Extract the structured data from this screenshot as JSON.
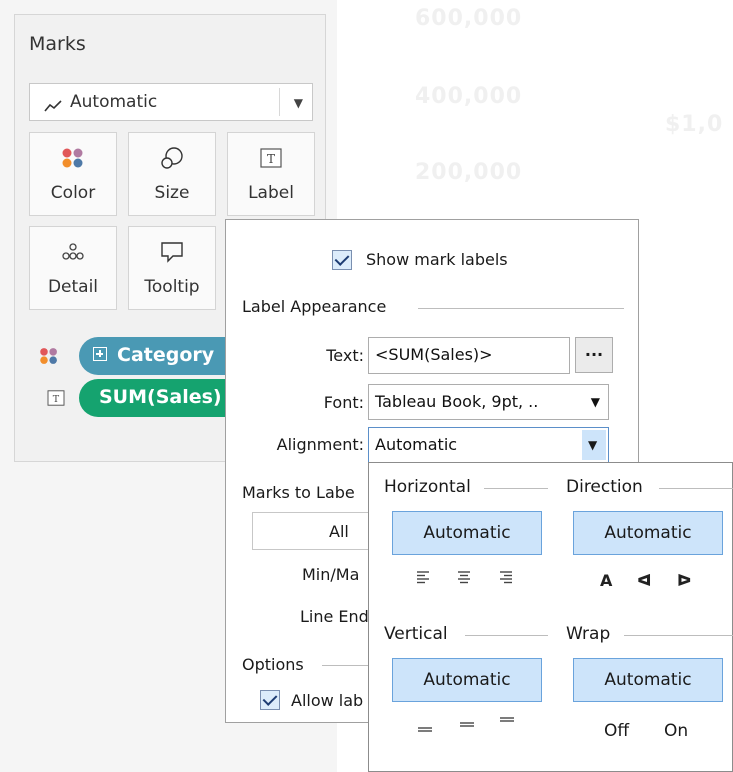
{
  "canvas": {
    "ghost_texts": [
      "600,000",
      "400,000",
      "200,000",
      "$1,0"
    ]
  },
  "marks": {
    "title": "Marks",
    "mark_type": {
      "value": "Automatic",
      "icon": "line-chart-icon"
    },
    "tiles": [
      {
        "label": "Color",
        "icon": "color-dots-icon"
      },
      {
        "label": "Size",
        "icon": "size-circles-icon"
      },
      {
        "label": "Label",
        "icon": "text-label-icon"
      },
      {
        "label": "Detail",
        "icon": "detail-dots-icon"
      },
      {
        "label": "Tooltip",
        "icon": "tooltip-bubble-icon"
      }
    ],
    "pills": [
      {
        "text": "Category",
        "prefix_icon": "expand-plus-icon",
        "shelf_icon": "color-dots-icon",
        "color": "#4a99b4"
      },
      {
        "text": "SUM(Sales)",
        "shelf_icon": "text-label-icon",
        "color": "#15a36f"
      }
    ]
  },
  "label_dialog": {
    "show_labels": "Show mark labels",
    "appearance_title": "Label Appearance",
    "text_label": "Text:",
    "text_value": "<SUM(Sales)>",
    "text_button": "...",
    "font_label": "Font:",
    "font_value": "Tableau Book, 9pt, ..",
    "alignment_label": "Alignment:",
    "alignment_value": "Automatic",
    "marks_to_label": "Marks to Labe",
    "all_button": "All",
    "min_max": "Min/Ma",
    "line_ends": "Line End",
    "options_title": "Options",
    "allow_label": "Allow lab"
  },
  "alignment_popup": {
    "horizontal": {
      "title": "Horizontal",
      "value": "Automatic",
      "glyphs": [
        "≡",
        "≡",
        "≡"
      ]
    },
    "direction": {
      "title": "Direction",
      "value": "Automatic",
      "glyphs": [
        "A",
        "ᐊ",
        "ᐅ"
      ]
    },
    "vertical": {
      "title": "Vertical",
      "value": "Automatic",
      "glyphs": [
        "≡",
        "≡",
        "≡"
      ]
    },
    "wrap": {
      "title": "Wrap",
      "value": "Automatic",
      "options": [
        "Off",
        "On"
      ]
    }
  },
  "colors": {
    "accent_selected": "#cde4fa",
    "accent_border": "#6aa3dc",
    "category_pill": "#4a99b4",
    "measure_pill": "#15a36f"
  }
}
